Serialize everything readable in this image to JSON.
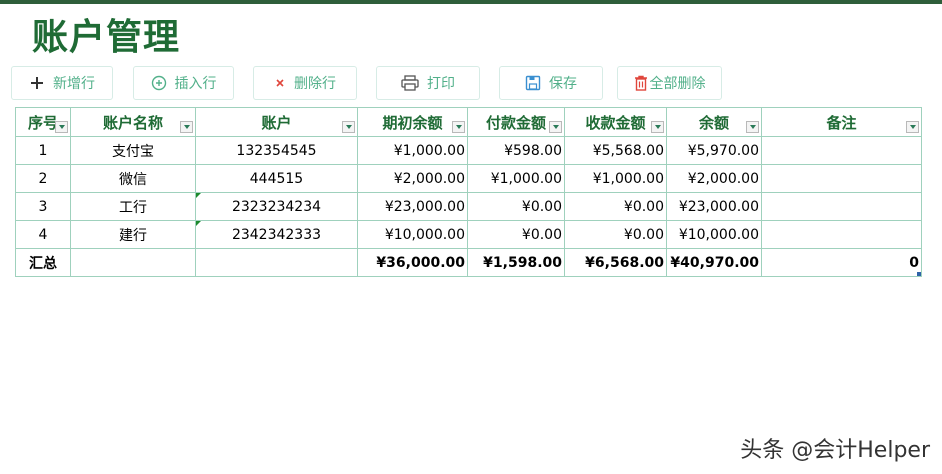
{
  "title": "账户管理",
  "toolbar": {
    "add_row": "新增行",
    "insert_row": "插入行",
    "delete_row": "删除行",
    "print": "打印",
    "save": "保存",
    "delete_all": "全部删除"
  },
  "table": {
    "headers": [
      "序号",
      "账户名称",
      "账户",
      "期初余额",
      "付款金额",
      "收款金额",
      "余额",
      "备注"
    ],
    "rows": [
      [
        "1",
        "支付宝",
        "132354545",
        "¥1,000.00",
        "¥598.00",
        "¥5,568.00",
        "¥5,970.00",
        ""
      ],
      [
        "2",
        "微信",
        "444515",
        "¥2,000.00",
        "¥1,000.00",
        "¥1,000.00",
        "¥2,000.00",
        ""
      ],
      [
        "3",
        "工行",
        "2323234234",
        "¥23,000.00",
        "¥0.00",
        "¥0.00",
        "¥23,000.00",
        ""
      ],
      [
        "4",
        "建行",
        "2342342333",
        "¥10,000.00",
        "¥0.00",
        "¥0.00",
        "¥10,000.00",
        ""
      ]
    ],
    "total": {
      "label": "汇总",
      "opening": "¥36,000.00",
      "payment": "¥1,598.00",
      "receipt": "¥6,568.00",
      "balance": "¥40,970.00",
      "remark": "0"
    }
  },
  "watermark": "头条 @会计Helper",
  "colors": {
    "title_green": "#1f6b35",
    "button_text": "#52b08a",
    "grid_border": "#9fd1bd",
    "delete_icon": "#e0463c"
  }
}
